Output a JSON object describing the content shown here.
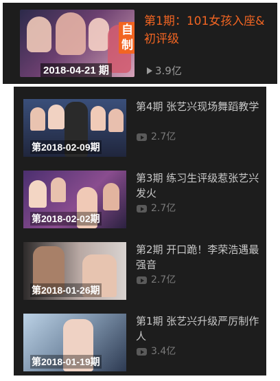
{
  "featured": {
    "badge": "自制",
    "date": "2018-04-21 期",
    "title": "第1期：101女孩入座&初评级",
    "views": "3.9亿",
    "accent_color": "#f26522",
    "icon": "play-icon"
  },
  "episodes": [
    {
      "date": "第2018-02-09期",
      "title": "第4期 张艺兴现场舞蹈教学",
      "views": "2.7亿",
      "icon": "video-icon"
    },
    {
      "date": "第2018-02-02期",
      "title": "第3期 练习生评级惹张艺兴发火",
      "views": "2.7亿",
      "icon": "video-icon"
    },
    {
      "date": "第2018-01-26期",
      "title": "第2期 开口跪！李荣浩遇最强音",
      "views": "2.7亿",
      "icon": "video-icon"
    },
    {
      "date": "第2018-01-19期",
      "title": "第1期 张艺兴升级严厉制作人",
      "views": "3.4亿",
      "icon": "video-icon"
    }
  ]
}
